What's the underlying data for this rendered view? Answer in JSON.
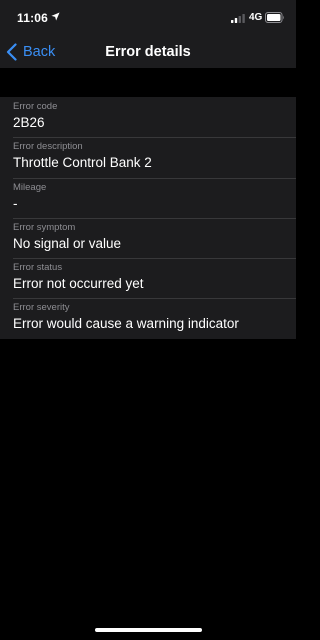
{
  "status_bar": {
    "time": "11:06",
    "location_icon": "location-arrow-icon",
    "signal_icon": "cellular-signal-icon",
    "network": "4G",
    "battery_icon": "battery-icon"
  },
  "nav": {
    "back_label": "Back",
    "back_icon": "chevron-left-icon",
    "title": "Error details"
  },
  "details": [
    {
      "label": "Error code",
      "value": "2B26"
    },
    {
      "label": "Error description",
      "value": "Throttle Control Bank 2"
    },
    {
      "label": "Mileage",
      "value": "-"
    },
    {
      "label": "Error symptom",
      "value": "No signal or value"
    },
    {
      "label": "Error status",
      "value": "Error not occurred yet"
    },
    {
      "label": "Error severity",
      "value": "Error would cause a warning indicator"
    }
  ],
  "colors": {
    "accent": "#3a8ff5",
    "background": "#000000",
    "surface": "#1c1c1e",
    "secondary_text": "#8e8e93"
  }
}
